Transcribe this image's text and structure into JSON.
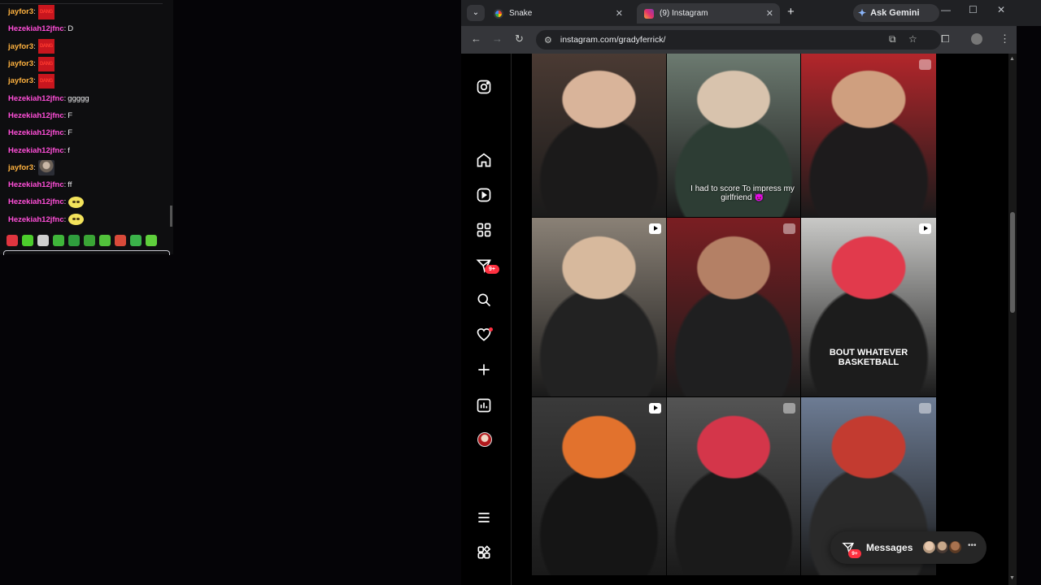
{
  "chat": {
    "lines": [
      {
        "user": "jayfor3",
        "user_color": "#ffb23f",
        "text": "",
        "emote": "dang-emote",
        "emote_text": "DANG"
      },
      {
        "user": "Hezekiah12jfnc",
        "user_color": "#ff4fd8",
        "text": "D",
        "emote": ""
      },
      {
        "user": "jayfor3",
        "user_color": "#ffb23f",
        "text": "",
        "emote": "dang-emote",
        "emote_text": "DANG"
      },
      {
        "user": "jayfor3",
        "user_color": "#ffb23f",
        "text": "",
        "emote": "dang-emote",
        "emote_text": "DANG"
      },
      {
        "user": "jayfor3",
        "user_color": "#ffb23f",
        "text": "",
        "emote": "dang-emote",
        "emote_text": "DANG"
      },
      {
        "user": "Hezekiah12jfnc",
        "user_color": "#ff4fd8",
        "text": "ggggg",
        "emote": ""
      },
      {
        "user": "Hezekiah12jfnc",
        "user_color": "#ff4fd8",
        "text": "F",
        "emote": ""
      },
      {
        "user": "Hezekiah12jfnc",
        "user_color": "#ff4fd8",
        "text": "F",
        "emote": ""
      },
      {
        "user": "Hezekiah12jfnc",
        "user_color": "#ff4fd8",
        "text": "f",
        "emote": ""
      },
      {
        "user": "jayfor3",
        "user_color": "#ffb23f",
        "text": "",
        "emote": "face-emote"
      },
      {
        "user": "Hezekiah12jfnc",
        "user_color": "#ff4fd8",
        "text": "ff",
        "emote": ""
      },
      {
        "user": "Hezekiah12jfnc",
        "user_color": "#ff4fd8",
        "text": "",
        "emote": "moon-emote"
      },
      {
        "user": "Hezekiah12jfnc",
        "user_color": "#ff4fd8",
        "text": "",
        "emote": "moon-emote"
      }
    ],
    "emote_bar_colors": [
      "#e0353f",
      "#4ccd2c",
      "#cfcfcf",
      "#3fb63a",
      "#2f9e3d",
      "#3aa535",
      "#52c23b",
      "#d94a3a",
      "#3bb34a",
      "#5fcf3c"
    ]
  },
  "browser": {
    "tabs": [
      {
        "title": "Snake",
        "icon": "google-icon",
        "active": false
      },
      {
        "title": "(9) Instagram",
        "icon": "instagram-icon",
        "active": true
      }
    ],
    "ask_gemini_label": "Ask Gemini",
    "url": "instagram.com/gradyferrick/"
  },
  "instagram": {
    "nav_items": [
      "instagram-logo",
      "home",
      "reels",
      "explore",
      "messages",
      "search",
      "notifications",
      "create",
      "dashboard",
      "profile",
      "more",
      "also-from-meta"
    ],
    "messages_badge": "9+",
    "messages_label": "Messages",
    "posts": [
      {
        "type": "none",
        "colors": [
          "#4a3a33",
          "#1b1a1a",
          "#d9b49a"
        ],
        "caption": ""
      },
      {
        "type": "none",
        "colors": [
          "#6c7a70",
          "#2d3d34",
          "#d8c3ad"
        ],
        "caption": "I had to score To impress my girlfriend 😈"
      },
      {
        "type": "carousel",
        "colors": [
          "#b3262b",
          "#1d1b1c",
          "#cf9f7f"
        ],
        "caption": ""
      },
      {
        "type": "reel",
        "colors": [
          "#8a8176",
          "#222",
          "#d7b99d"
        ],
        "caption": ""
      },
      {
        "type": "carousel",
        "colors": [
          "#7a1e22",
          "#1f1f20",
          "#b48065"
        ],
        "caption": ""
      },
      {
        "type": "reel",
        "colors": [
          "#c9c9c7",
          "#1c1c1c",
          "#e13a4c"
        ],
        "caption": ""
      },
      {
        "type": "reel",
        "colors": [
          "#3a3a3a",
          "#151515",
          "#e2722d"
        ],
        "caption": ""
      },
      {
        "type": "carousel",
        "colors": [
          "#545454",
          "#1a1a1a",
          "#d4364a"
        ],
        "caption": ""
      },
      {
        "type": "carousel",
        "colors": [
          "#6d7c94",
          "#2a2a2a",
          "#c33b30"
        ],
        "caption": ""
      }
    ],
    "shirt_text": "BOUT WHATEVER BASKETBALL"
  }
}
